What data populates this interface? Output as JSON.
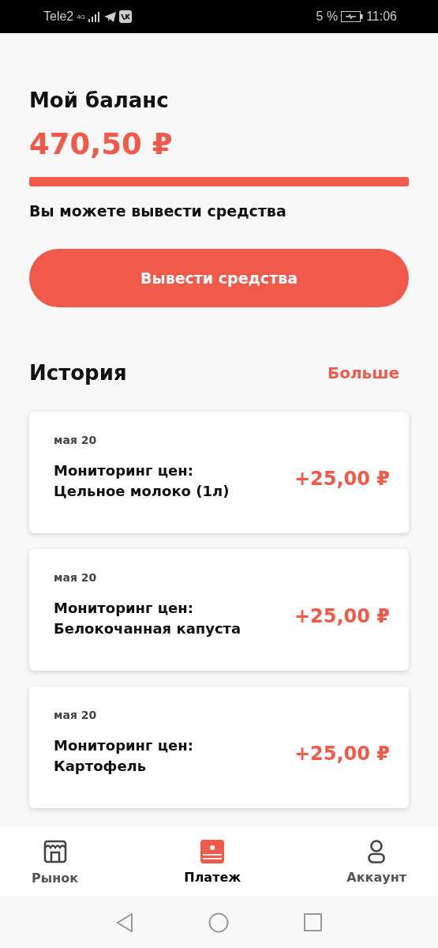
{
  "status_bar": {
    "carrier": "Tele2",
    "network": "4G",
    "battery": "5 %",
    "time": "11:06"
  },
  "balance": {
    "title": "Мой баланс",
    "amount": "470,50 ₽",
    "level": 1,
    "note": "Вы можете вывести средства"
  },
  "withdraw_button": "Вывести средства",
  "history": {
    "title": "История",
    "more": "Больше",
    "items": [
      {
        "date": "мая 20",
        "title": "Мониторинг цен:",
        "subtitle": "Цельное молоко (1л)",
        "amount": "+25,00 ₽"
      },
      {
        "date": "мая 20",
        "title": "Мониторинг цен:",
        "subtitle": "Белокочанная капуста",
        "amount": "+25,00 ₽"
      },
      {
        "date": "мая 20",
        "title": "Мониторинг цен:",
        "subtitle": "Картофель",
        "amount": "+25,00 ₽"
      }
    ]
  },
  "tabs": [
    {
      "kind": "market",
      "label": "Рынок",
      "selected": false
    },
    {
      "kind": "payment",
      "label": "Платеж",
      "selected": true
    },
    {
      "kind": "account",
      "label": "Аккаунт",
      "selected": false
    }
  ]
}
